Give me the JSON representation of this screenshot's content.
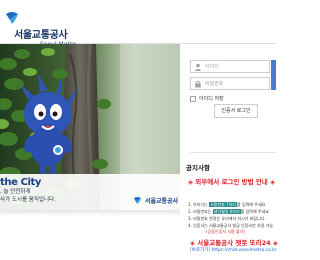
{
  "header": {
    "title": "서울교통공사",
    "subtitle": "Seoul Metro"
  },
  "hero": {
    "brand": "the City",
    "line1": ", 늘 안전하게",
    "line2": "사가 도시를 움직입니다.",
    "footer_logo": "서울교통공사"
  },
  "login": {
    "id_placeholder": "아이디",
    "pw_placeholder": "비밀번호",
    "keep_label": "아이디 저장",
    "cert_label": "인증서 로그인"
  },
  "notice": {
    "title": "공지사항",
    "headline": "◈ 외부에서 로그인 방법 안내 ◈",
    "items": [
      "1. 아이디는 ",
      "2. 비밀번호는 ",
      "3. 비밀번호 변경은 유리"
    ],
    "item1_hl": "사원번호 7자리",
    "item1_tail": "를 입력해 주세요",
    "item2_hl": "생년월일 6자리",
    "item2_tail": "를 입력해 주세요",
    "item3_tail": "에서 하시기 바랍니다",
    "item4": "4. 인증서는 서울교통공사 발급 인증서만 사용 가능",
    "item4b": "(공동인증서 사용 불가)",
    "chat_title": "◈ 서울교통공사 챗봇 또리24 ◈",
    "chat_link": "[바로가기] https://chat.seoulmetro.co.kr"
  },
  "colors": {
    "brand_navy": "#13325f",
    "login_blue": "#4a7bd3",
    "notice_red": "#d7262c"
  }
}
